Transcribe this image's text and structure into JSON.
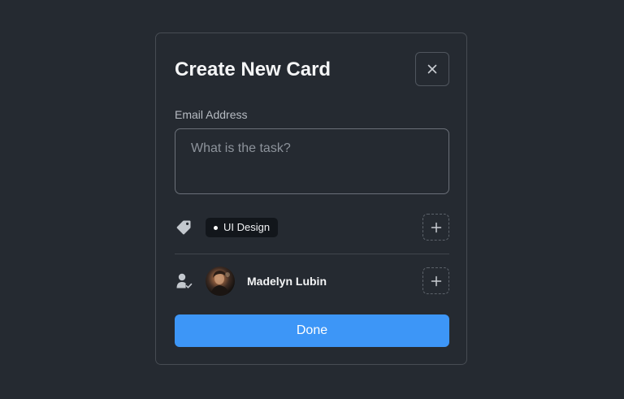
{
  "modal": {
    "title": "Create New Card",
    "close_icon": "close-icon"
  },
  "task": {
    "label": "Email Address",
    "placeholder": "What is the task?",
    "value": ""
  },
  "tags": {
    "icon": "tag-icon",
    "items": [
      {
        "label": "UI Design",
        "dot_color": "#ffffff"
      }
    ],
    "add_icon": "plus-icon"
  },
  "assignees": {
    "icon": "user-check-icon",
    "items": [
      {
        "name": "Madelyn Lubin",
        "avatar": "avatar-photo"
      }
    ],
    "add_icon": "plus-icon"
  },
  "actions": {
    "done_label": "Done"
  },
  "colors": {
    "background": "#252a31",
    "border": "#474c53",
    "accent": "#3d96f7",
    "chip": "#12161b"
  }
}
